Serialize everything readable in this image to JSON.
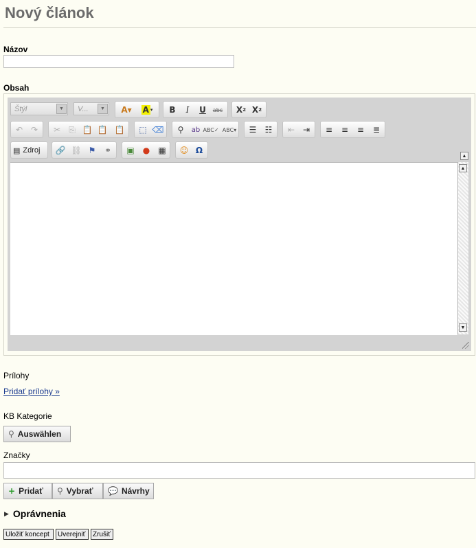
{
  "page": {
    "title": "Nový článok"
  },
  "form": {
    "name_label": "Názov",
    "name_value": "",
    "content_label": "Obsah",
    "attachments_label": "Prílohy",
    "attachments_link": "Pridať prílohy »",
    "kb_label": "KB Kategorie",
    "kb_select_button": "Auswählen",
    "tags_label": "Značky",
    "tags_value": "",
    "tag_buttons": {
      "add": "Pridať",
      "choose": "Vybrať",
      "suggest": "Návrhy"
    },
    "permissions_toggle": "Oprávnenia"
  },
  "editor": {
    "style_combo": "Štýl",
    "size_combo": "V...",
    "source_button": "Zdroj",
    "icons": {
      "row1": [
        "text-color-icon",
        "bg-color-icon",
        "bold-icon",
        "italic-icon",
        "underline-icon",
        "strike-icon",
        "subscript-icon",
        "superscript-icon"
      ],
      "row2": [
        "undo-icon",
        "redo-icon",
        "cut-icon",
        "copy-icon",
        "paste-icon",
        "paste-text-icon",
        "paste-word-icon",
        "select-all-icon",
        "remove-format-icon",
        "find-icon",
        "replace-icon",
        "spellcheck-icon",
        "scayt-icon",
        "numbered-list-icon",
        "bullet-list-icon",
        "outdent-icon",
        "indent-icon",
        "align-left-icon",
        "align-center-icon",
        "align-right-icon",
        "justify-icon"
      ],
      "row3": [
        "source-icon",
        "link-icon",
        "unlink-icon",
        "anchor-icon",
        "page-link-icon",
        "image-icon",
        "flash-icon",
        "table-icon",
        "smiley-icon",
        "special-char-icon"
      ]
    }
  },
  "actions": {
    "save_draft": "Uložiť koncept",
    "publish": "Uverejniť",
    "cancel": "Zrušiť"
  },
  "colors": {
    "background": "#fdfdf3",
    "link": "#1a3a8f",
    "title": "#6b6b6b"
  }
}
